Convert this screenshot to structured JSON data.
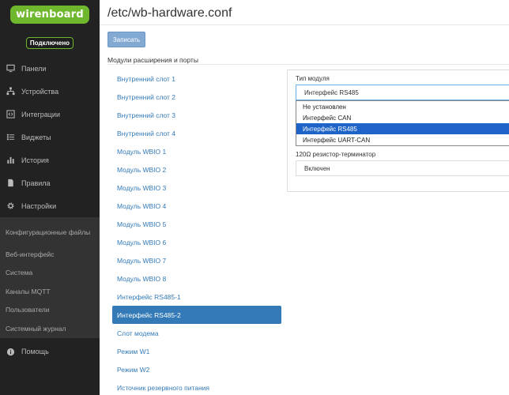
{
  "brand": {
    "logo_text": "wirenboard"
  },
  "status": {
    "label": "Подключено"
  },
  "nav": {
    "items": [
      {
        "label": "Панели",
        "icon": "monitor-icon"
      },
      {
        "label": "Устройства",
        "icon": "sitemap-icon"
      },
      {
        "label": "Интеграции",
        "icon": "code-icon"
      },
      {
        "label": "Виджеты",
        "icon": "list-icon"
      },
      {
        "label": "История",
        "icon": "bar-chart-icon"
      },
      {
        "label": "Правила",
        "icon": "file-icon"
      },
      {
        "label": "Настройки",
        "icon": "gear-icon"
      }
    ],
    "submenu": [
      "Конфигурационные файлы",
      "Веб-интерфейс",
      "Система",
      "Каналы MQTT",
      "Пользователи",
      "Системный журнал"
    ],
    "help": {
      "label": "Помощь",
      "icon": "info-icon"
    }
  },
  "main": {
    "title": "/etc/wb-hardware.conf",
    "save_label": "Записать",
    "section_label": "Модули расширения и порты",
    "modules": [
      "Внутренний слот 1",
      "Внутренний слот 2",
      "Внутренний слот 3",
      "Внутренний слот 4",
      "Модуль WBIO 1",
      "Модуль WBIO 2",
      "Модуль WBIO 3",
      "Модуль WBIO 4",
      "Модуль WBIO 5",
      "Модуль WBIO 6",
      "Модуль WBIO 7",
      "Модуль WBIO 8",
      "Интерфейс RS485-1",
      "Интерфейс RS485-2",
      "Слот модема",
      "Режим W1",
      "Режим W2",
      "Источник резервного питания"
    ],
    "active_module_index": 13
  },
  "panel": {
    "module_type_label": "Тип модуля",
    "module_type_value": "Интерфейс RS485",
    "options": [
      "Не установлен",
      "Интерфейс CAN",
      "Интерфейс RS485",
      "Интерфейс UART-CAN"
    ],
    "selected_option_index": 2,
    "terminator_label": "120Ω резистор-терминатор",
    "terminator_value": "Включен"
  },
  "colors": {
    "sidebar_bg": "#222222",
    "submenu_bg": "#333333",
    "brand_green": "#6fb82d",
    "link_blue": "#337ab7",
    "dropdown_selected": "#1e64c8"
  }
}
